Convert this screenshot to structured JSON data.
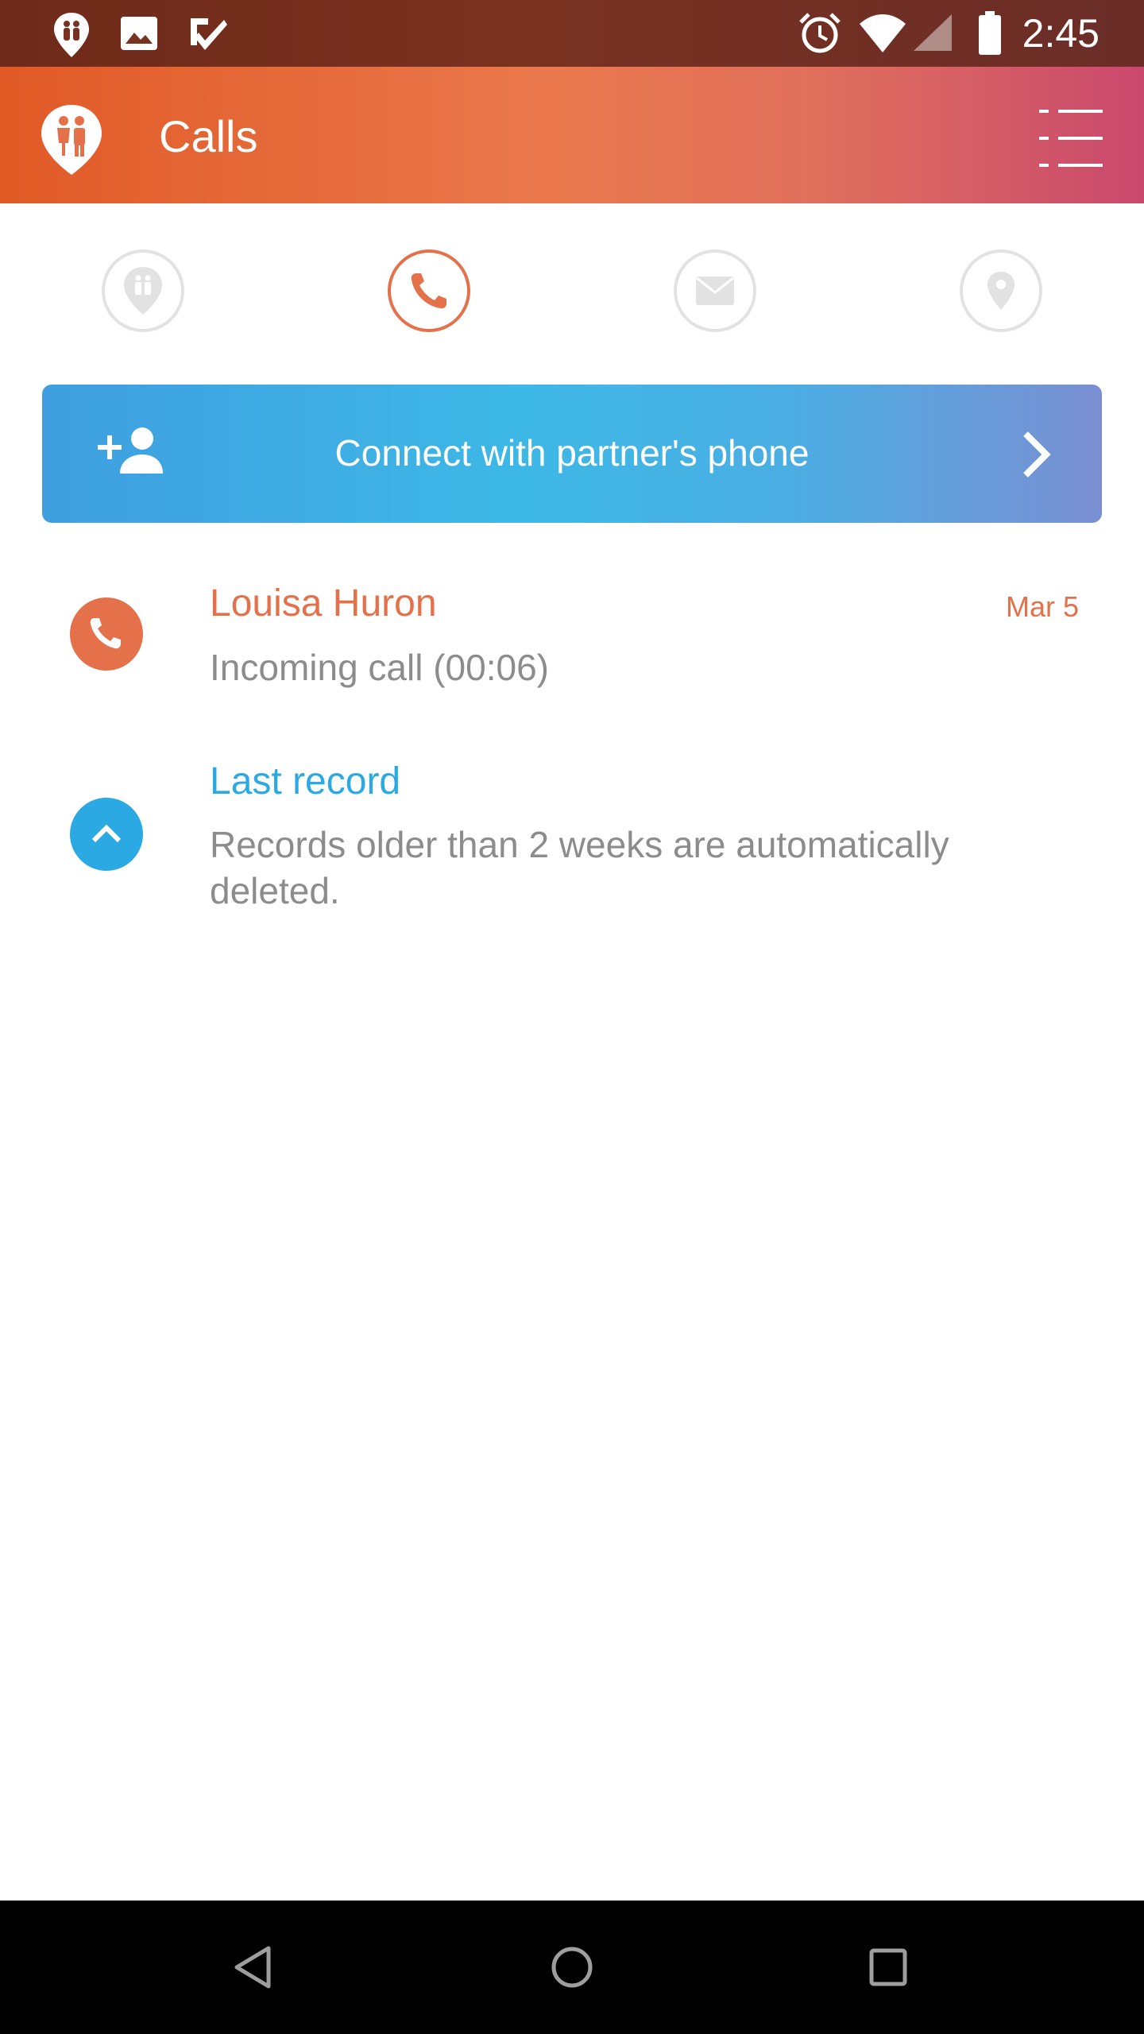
{
  "status_bar": {
    "time": "2:45",
    "left_icons": [
      "app-logo-icon",
      "image-icon",
      "check-icon"
    ],
    "right_icons": [
      "alarm-icon",
      "wifi-icon",
      "signal-icon",
      "battery-icon"
    ]
  },
  "app_bar": {
    "title": "Calls",
    "logo_icon": "couple-pin-icon",
    "menu_icon": "list-menu-icon",
    "gradient": [
      "#e15a26",
      "#ea784c",
      "#c9496e"
    ]
  },
  "tabs": [
    {
      "name": "partner",
      "icon": "couple-pin-icon",
      "active": false
    },
    {
      "name": "calls",
      "icon": "phone-icon",
      "active": true
    },
    {
      "name": "messages",
      "icon": "envelope-icon",
      "active": false
    },
    {
      "name": "location",
      "icon": "location-pin-icon",
      "active": false
    }
  ],
  "connect": {
    "label": "Connect with partner's phone",
    "icon": "add-person-icon",
    "chevron": "chevron-right-icon"
  },
  "calls": [
    {
      "name": "Louisa Huron",
      "date": "Mar 5",
      "detail": "Incoming call (00:06)",
      "icon": "phone-icon"
    }
  ],
  "last_record": {
    "title": "Last record",
    "description": "Records older than 2 weeks are automatically deleted.",
    "icon": "chevron-up-icon"
  },
  "colors": {
    "accent_orange": "#e4714a",
    "accent_blue": "#2aa9e3",
    "muted_text": "#8c8c8c"
  },
  "nav_bar": {
    "icons": [
      "back-icon",
      "home-icon",
      "recents-icon"
    ]
  }
}
